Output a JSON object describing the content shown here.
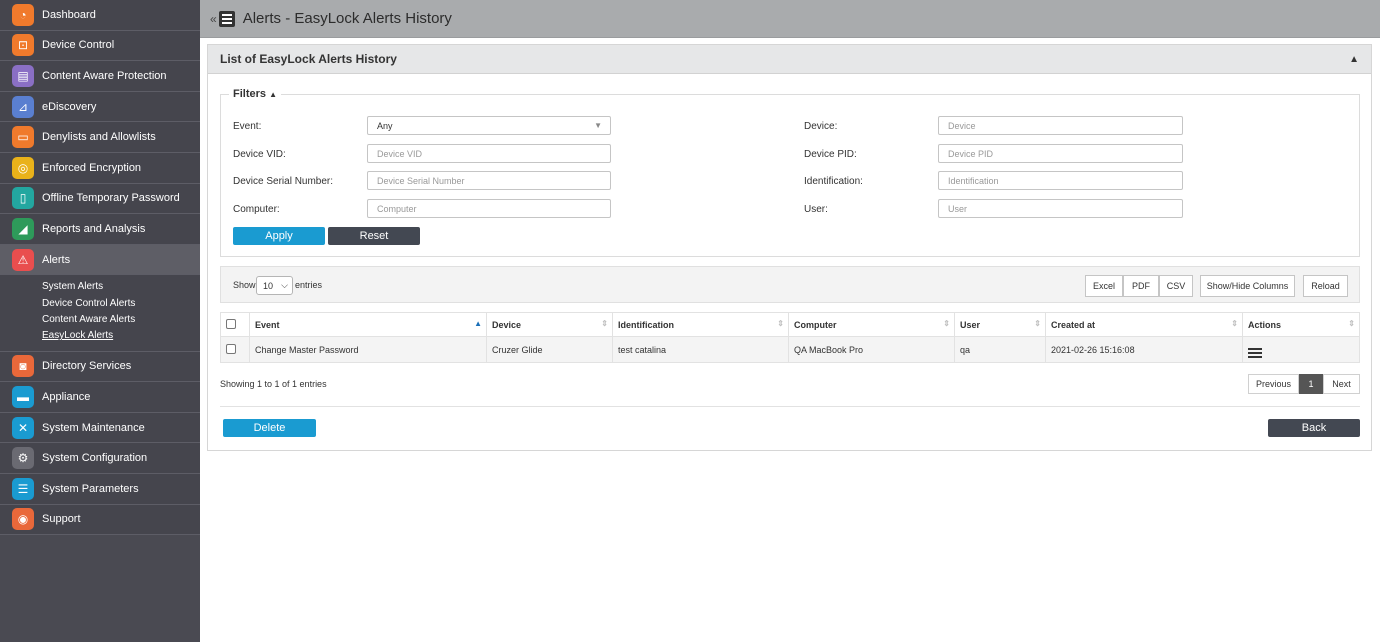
{
  "sidebar": {
    "items": [
      {
        "label": "Dashboard",
        "icon": "dashboard-icon",
        "color": "#f07a2c",
        "glyph": "◔"
      },
      {
        "label": "Device Control",
        "icon": "usb-icon",
        "color": "#f07a2c",
        "glyph": "⊡"
      },
      {
        "label": "Content Aware Protection",
        "icon": "document-icon",
        "color": "#8a6fc4",
        "glyph": "▤"
      },
      {
        "label": "eDiscovery",
        "icon": "telescope-icon",
        "color": "#5a7fd0",
        "glyph": "⊿"
      },
      {
        "label": "Denylists and Allowlists",
        "icon": "list-icon",
        "color": "#f07a2c",
        "glyph": "▭"
      },
      {
        "label": "Enforced Encryption",
        "icon": "encryption-icon",
        "color": "#e9b21a",
        "glyph": "◎"
      },
      {
        "label": "Offline Temporary Password",
        "icon": "key-icon",
        "color": "#23a7a0",
        "glyph": "▯"
      },
      {
        "label": "Reports and Analysis",
        "icon": "chart-icon",
        "color": "#2e9a5a",
        "glyph": "◢"
      },
      {
        "label": "Alerts",
        "icon": "warning-icon",
        "color": "#e94e4e",
        "glyph": "⚠"
      }
    ],
    "alerts_sub": [
      "System Alerts",
      "Device Control Alerts",
      "Content Aware Alerts",
      "EasyLock Alerts"
    ],
    "items_after": [
      {
        "label": "Directory Services",
        "icon": "directory-icon",
        "color": "#e9683a",
        "glyph": "◙"
      },
      {
        "label": "Appliance",
        "icon": "appliance-icon",
        "color": "#1a9bd1",
        "glyph": "▬"
      },
      {
        "label": "System Maintenance",
        "icon": "tools-icon",
        "color": "#1a9bd1",
        "glyph": "✕"
      },
      {
        "label": "System Configuration",
        "icon": "gear-icon",
        "color": "#6a6a72",
        "glyph": "⚙"
      },
      {
        "label": "System Parameters",
        "icon": "parameters-icon",
        "color": "#1a9bd1",
        "glyph": "☰"
      },
      {
        "label": "Support",
        "icon": "lifebuoy-icon",
        "color": "#e9683a",
        "glyph": "◉"
      }
    ]
  },
  "header": {
    "title": "Alerts - EasyLock Alerts History"
  },
  "panel": {
    "title": "List of EasyLock Alerts History"
  },
  "filters": {
    "legend": "Filters",
    "event_label": "Event:",
    "event_value": "Any",
    "device_label": "Device:",
    "device_placeholder": "Device",
    "vid_label": "Device VID:",
    "vid_placeholder": "Device VID",
    "pid_label": "Device PID:",
    "pid_placeholder": "Device PID",
    "serial_label": "Device Serial Number:",
    "serial_placeholder": "Device Serial Number",
    "ident_label": "Identification:",
    "ident_placeholder": "Identification",
    "computer_label": "Computer:",
    "computer_placeholder": "Computer",
    "user_label": "User:",
    "user_placeholder": "User",
    "apply": "Apply",
    "reset": "Reset"
  },
  "toolbar": {
    "show": "Show",
    "entries_value": "10",
    "entries": "entries",
    "excel": "Excel",
    "pdf": "PDF",
    "csv": "CSV",
    "show_hide": "Show/Hide Columns",
    "reload": "Reload"
  },
  "table": {
    "columns": [
      "Event",
      "Device",
      "Identification",
      "Computer",
      "User",
      "Created at",
      "Actions"
    ],
    "rows": [
      {
        "event": "Change Master Password",
        "device": "Cruzer Glide",
        "identification": "test catalina",
        "computer": "QA MacBook Pro",
        "user": "qa",
        "created": "2021-02-26 15:16:08"
      }
    ]
  },
  "footer": {
    "info": "Showing 1 to 1 of 1 entries",
    "previous": "Previous",
    "page": "1",
    "next": "Next",
    "delete": "Delete",
    "back": "Back"
  }
}
